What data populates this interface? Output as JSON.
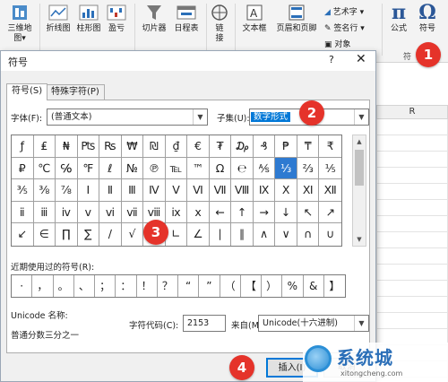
{
  "ribbon": {
    "buttons": [
      {
        "label": "三维地\n图▾",
        "icon": "3d-map-icon"
      },
      {
        "label": "折线图",
        "icon": "line-sparkline-icon"
      },
      {
        "label": "柱形图",
        "icon": "column-sparkline-icon"
      },
      {
        "label": "盈亏",
        "icon": "win-loss-icon"
      },
      {
        "label": "切片器",
        "icon": "slicer-icon"
      },
      {
        "label": "日程表",
        "icon": "timeline-icon"
      },
      {
        "label": "链\n接",
        "icon": "link-icon"
      },
      {
        "label": "文本框",
        "icon": "textbox-icon"
      },
      {
        "label": "页眉和页脚",
        "icon": "header-footer-icon"
      },
      {
        "label": "公式",
        "icon": "pi-icon"
      },
      {
        "label": "符号",
        "icon": "omega-icon"
      }
    ],
    "small_items": [
      "艺术字 ▾",
      "签名行 ▾",
      "对象"
    ],
    "group_label": "符"
  },
  "sheet": {
    "column_label": "R"
  },
  "dialog": {
    "title": "符号",
    "help": "?",
    "close": "✕",
    "tabs": [
      "符号(S)",
      "特殊字符(P)"
    ],
    "font_label": "字体(F):",
    "font_value": "(普通文本)",
    "subset_label": "子集(U):",
    "subset_value": "数字形式",
    "symbols": [
      [
        "ƒ",
        "₤",
        "₦",
        "₧",
        "₨",
        "₩",
        "₪",
        "₫",
        "€",
        "₮",
        "₯",
        "₰",
        "₱",
        "₸",
        "₹"
      ],
      [
        "₽",
        "℃",
        "℅",
        "℉",
        "ℓ",
        "№",
        "℗",
        "℡",
        "™",
        "Ω",
        "℮",
        "⅍",
        "⅓",
        "⅔",
        "⅕"
      ],
      [
        "⅗",
        "⅜",
        "⅞",
        "Ⅰ",
        "Ⅱ",
        "Ⅲ",
        "Ⅳ",
        "Ⅴ",
        "Ⅵ",
        "Ⅶ",
        "Ⅷ",
        "Ⅸ",
        "Ⅹ",
        "Ⅺ",
        "Ⅻ"
      ],
      [
        "ⅱ",
        "ⅲ",
        "ⅳ",
        "ⅴ",
        "ⅵ",
        "ⅶ",
        "ⅷ",
        "ⅸ",
        "ⅹ",
        "←",
        "↑",
        "→",
        "↓",
        "↖",
        "↗"
      ],
      [
        "↙",
        "∈",
        "∏",
        "∑",
        "∕",
        "√",
        "∞",
        "∟",
        "∠",
        "∣",
        "∥",
        "∧",
        "∨",
        "∩",
        "∪"
      ]
    ],
    "selected_symbol": "⅓",
    "recent_label": "近期使用过的符号(R):",
    "recent_symbols": [
      "·",
      "，",
      "。",
      "、",
      "；",
      "：",
      "！",
      "？",
      "“",
      "”",
      "（",
      "【",
      "）",
      "%",
      "&",
      "】"
    ],
    "unicode_name_label": "Unicode 名称:",
    "unicode_name_value": "普通分数三分之一",
    "char_code_label": "字符代码(C):",
    "char_code_value": "2153",
    "from_label": "来自(M):",
    "from_value": "Unicode(十六进制)",
    "insert_button": "插入(I)",
    "cancel_button": "取消"
  },
  "annotations": [
    "1",
    "2",
    "3",
    "4"
  ],
  "watermark": {
    "text": "系统城",
    "url": "xitongcheng.com"
  },
  "colors": {
    "accent": "#0078d7",
    "badge": "#e5332a"
  }
}
